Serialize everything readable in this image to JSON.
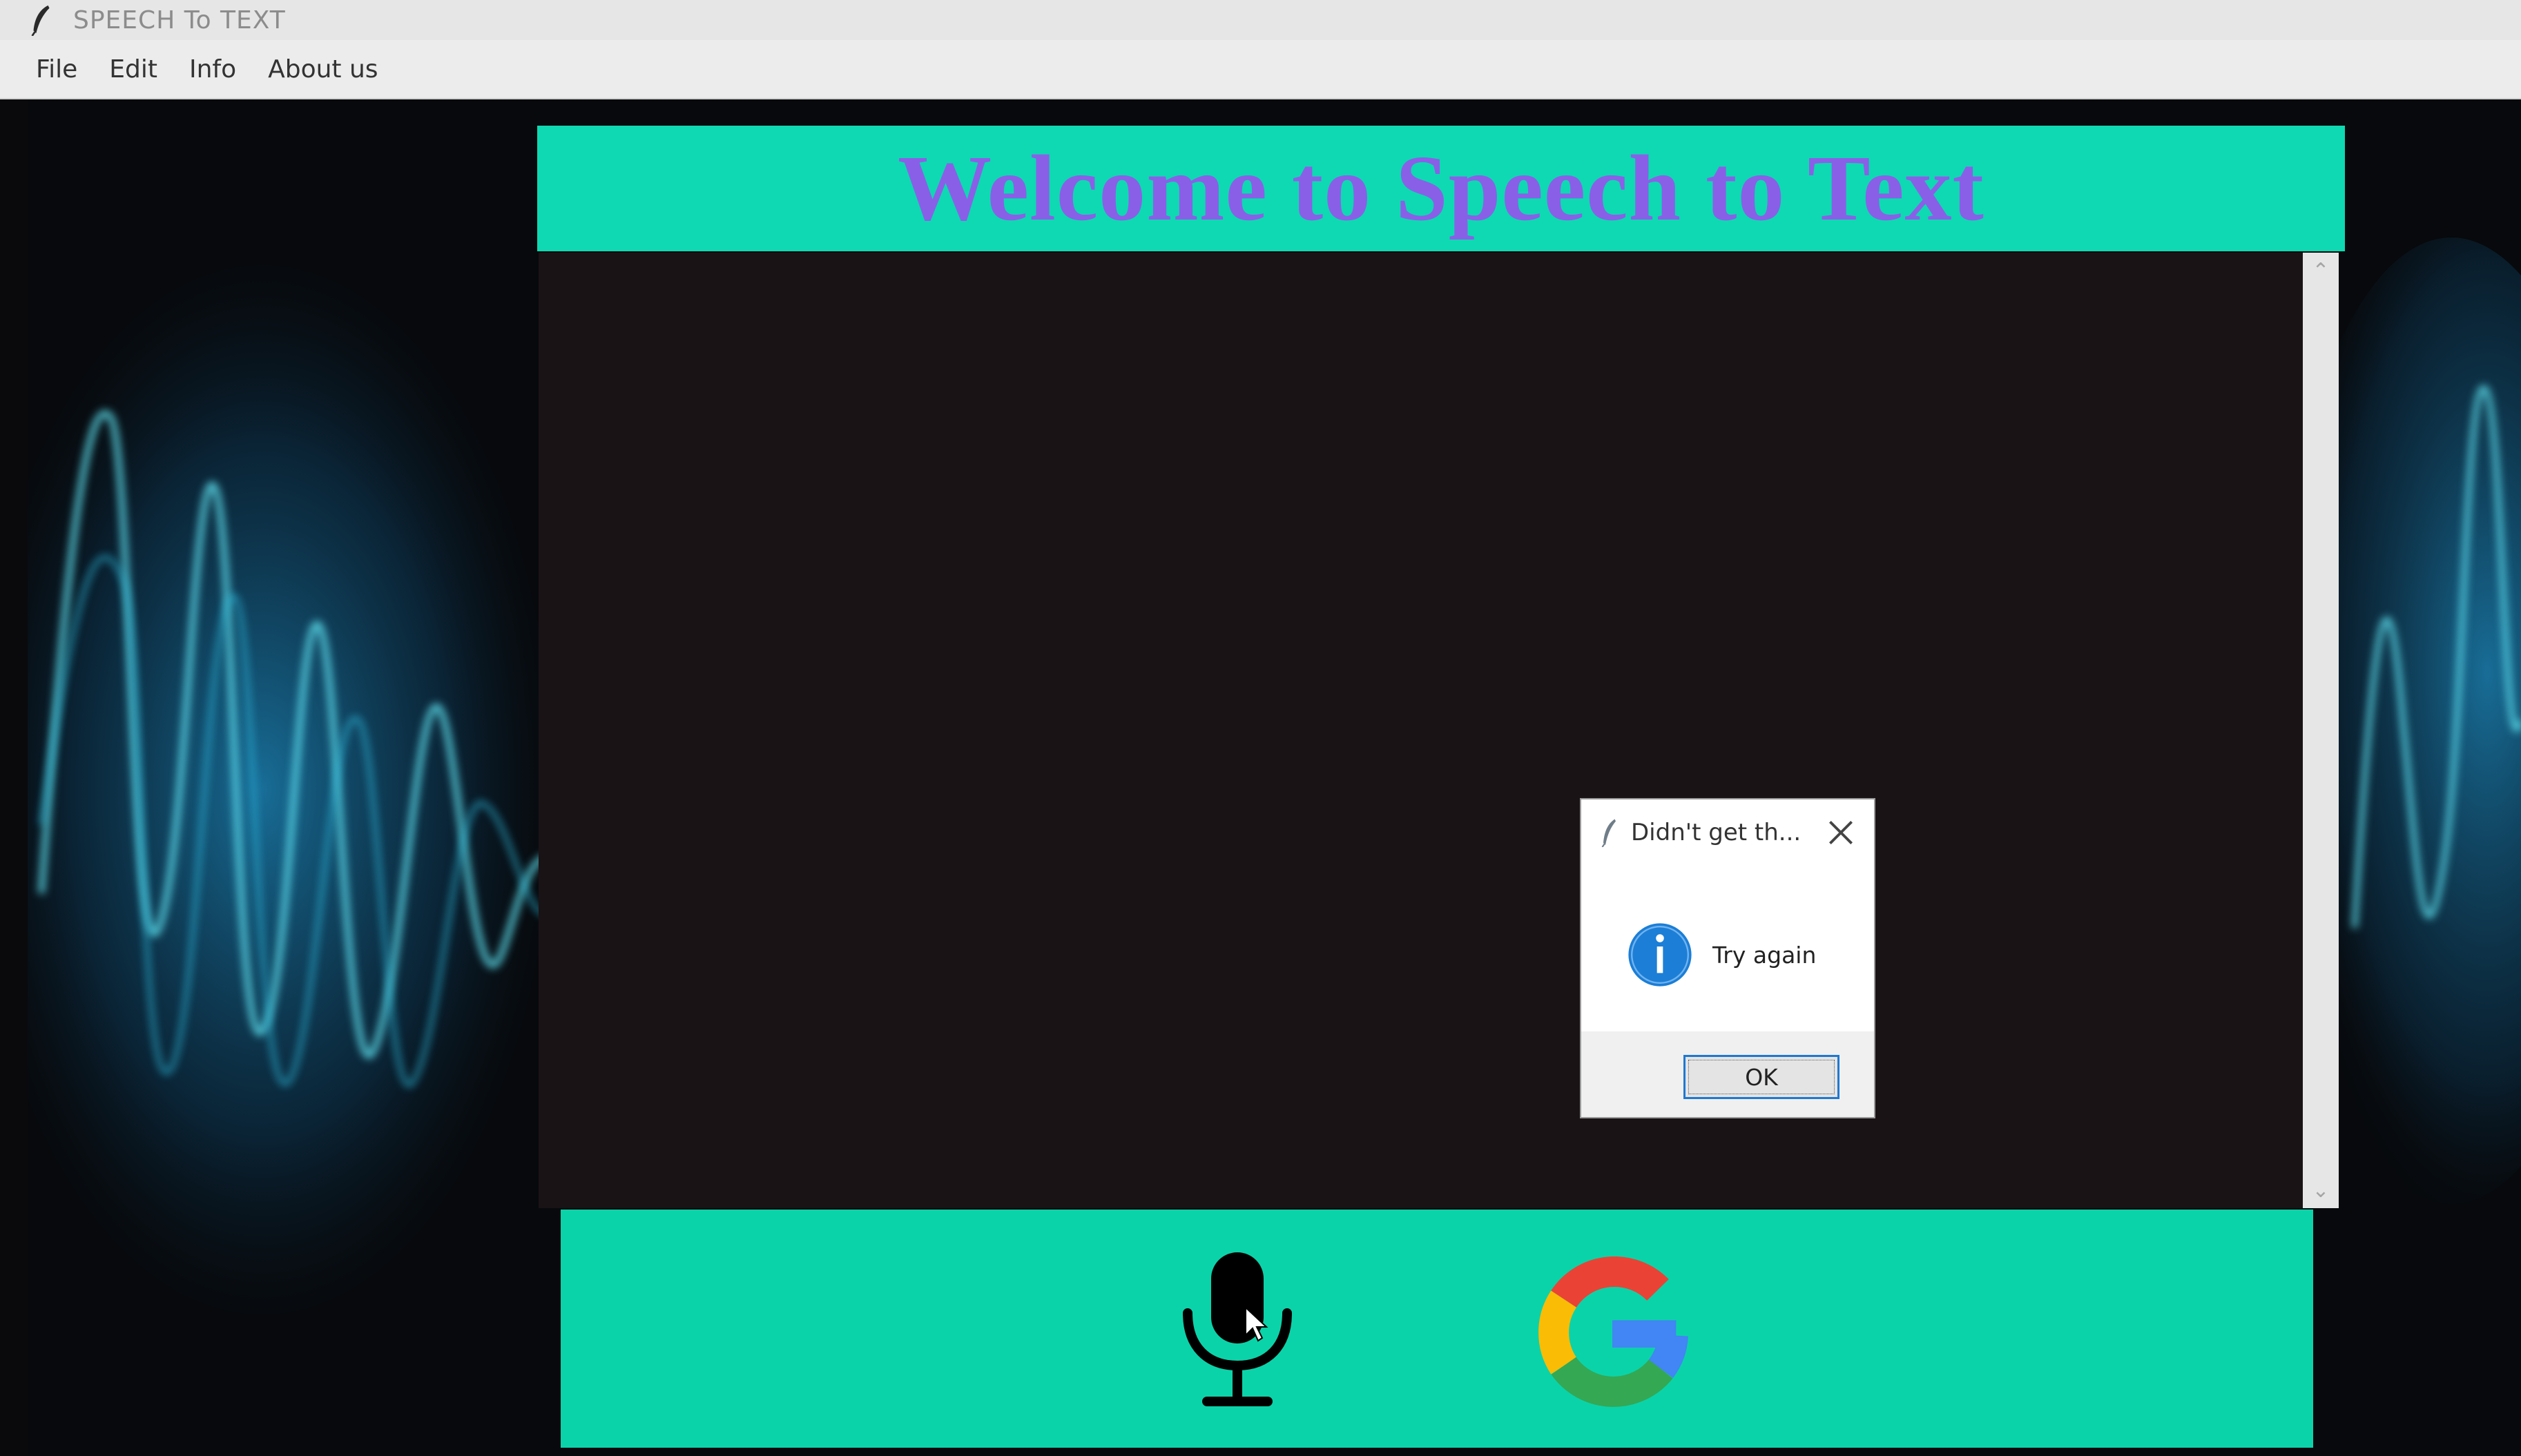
{
  "window": {
    "title": "SPEECH To TEXT",
    "icon": "feather-icon"
  },
  "menu": {
    "items": [
      "File",
      "Edit",
      "Info",
      "About us"
    ]
  },
  "header": {
    "welcome": "Welcome to Speech to Text"
  },
  "output": {
    "text": ""
  },
  "controls": {
    "mic_icon": "microphone-icon",
    "google_icon": "google-g-icon"
  },
  "dialog": {
    "title": "Didn't get th...",
    "message": "Try again",
    "ok_label": "OK",
    "icon": "info-icon"
  },
  "colors": {
    "band": "#0ed9b2",
    "welcome_text": "#8a5fe8",
    "output_bg": "#1a1315",
    "wave_glow": "#21b6e8"
  }
}
